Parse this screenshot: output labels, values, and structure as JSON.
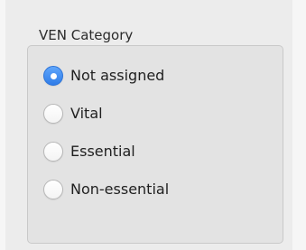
{
  "group": {
    "title": "VEN Category",
    "options": [
      {
        "label": "Not assigned",
        "selected": true
      },
      {
        "label": "Vital",
        "selected": false
      },
      {
        "label": "Essential",
        "selected": false
      },
      {
        "label": "Non-essential",
        "selected": false
      }
    ]
  },
  "colors": {
    "accent": "#2f7ce8",
    "panel": "#e3e3e3",
    "background": "#ececec"
  }
}
